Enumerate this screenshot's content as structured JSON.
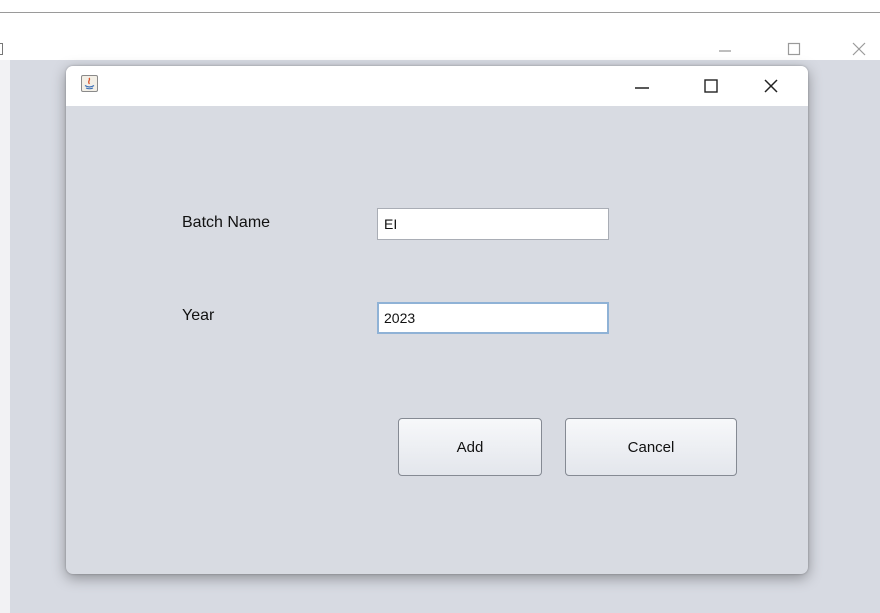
{
  "outer_window": {
    "controls": {
      "minimize": "—",
      "maximize": "☐",
      "close": "✕"
    }
  },
  "dialog": {
    "controls": {
      "minimize": "—",
      "maximize": "☐",
      "close": "✕"
    },
    "form": {
      "batch_name_label": "Batch Name",
      "batch_name_value": "EI",
      "year_label": "Year",
      "year_value": "2023"
    },
    "buttons": {
      "add_label": "Add",
      "cancel_label": "Cancel"
    }
  }
}
